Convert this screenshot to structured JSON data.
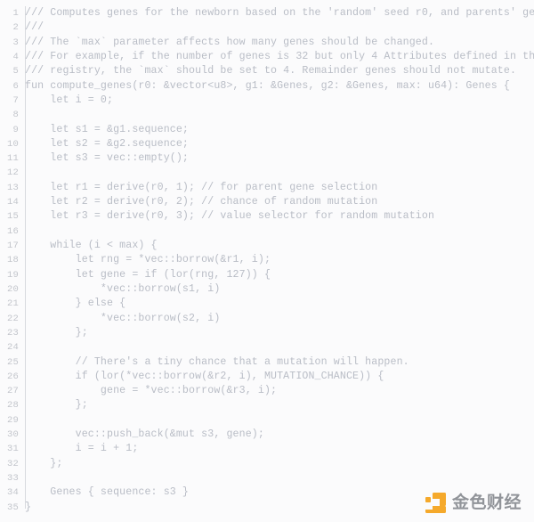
{
  "editor": {
    "language": "move",
    "total_lines": 35,
    "first_line_number": 1,
    "colors": {
      "background": "#fbfbfc",
      "text": "#b9bdc6",
      "line_number": "#c3c6cc",
      "gutter_rule": "#d8dade",
      "watermark_accent": "#f5a623",
      "watermark_text": "#8d9096"
    },
    "lines": [
      {
        "n": "1",
        "text": "/// Computes genes for the newborn based on the 'random' seed r0, and parents' genes."
      },
      {
        "n": "2",
        "text": "///"
      },
      {
        "n": "3",
        "text": "/// The `max` parameter affects how many genes should be changed."
      },
      {
        "n": "4",
        "text": "/// For example, if the number of genes is 32 but only 4 Attributes defined in the"
      },
      {
        "n": "5",
        "text": "/// registry, the `max` should be set to 4. Remainder genes should not mutate."
      },
      {
        "n": "6",
        "text": "fun compute_genes(r0: &vector<u8>, g1: &Genes, g2: &Genes, max: u64): Genes {"
      },
      {
        "n": "7",
        "text": "    let i = 0;"
      },
      {
        "n": "8",
        "text": ""
      },
      {
        "n": "9",
        "text": "    let s1 = &g1.sequence;"
      },
      {
        "n": "10",
        "text": "    let s2 = &g2.sequence;"
      },
      {
        "n": "11",
        "text": "    let s3 = vec::empty();"
      },
      {
        "n": "12",
        "text": ""
      },
      {
        "n": "13",
        "text": "    let r1 = derive(r0, 1); // for parent gene selection"
      },
      {
        "n": "14",
        "text": "    let r2 = derive(r0, 2); // chance of random mutation"
      },
      {
        "n": "15",
        "text": "    let r3 = derive(r0, 3); // value selector for random mutation"
      },
      {
        "n": "16",
        "text": ""
      },
      {
        "n": "17",
        "text": "    while (i < max) {"
      },
      {
        "n": "18",
        "text": "        let rng = *vec::borrow(&r1, i);"
      },
      {
        "n": "19",
        "text": "        let gene = if (lor(rng, 127)) {"
      },
      {
        "n": "20",
        "text": "            *vec::borrow(s1, i)"
      },
      {
        "n": "21",
        "text": "        } else {"
      },
      {
        "n": "22",
        "text": "            *vec::borrow(s2, i)"
      },
      {
        "n": "23",
        "text": "        };"
      },
      {
        "n": "24",
        "text": ""
      },
      {
        "n": "25",
        "text": "        // There's a tiny chance that a mutation will happen."
      },
      {
        "n": "26",
        "text": "        if (lor(*vec::borrow(&r2, i), MUTATION_CHANCE)) {"
      },
      {
        "n": "27",
        "text": "            gene = *vec::borrow(&r3, i);"
      },
      {
        "n": "28",
        "text": "        };"
      },
      {
        "n": "29",
        "text": ""
      },
      {
        "n": "30",
        "text": "        vec::push_back(&mut s3, gene);"
      },
      {
        "n": "31",
        "text": "        i = i + 1;"
      },
      {
        "n": "32",
        "text": "    };"
      },
      {
        "n": "33",
        "text": ""
      },
      {
        "n": "34",
        "text": "    Genes { sequence: s3 }"
      },
      {
        "n": "35",
        "text": "}"
      }
    ]
  },
  "watermark": {
    "label": "金色财经",
    "icon": "jinse-logo-icon"
  }
}
